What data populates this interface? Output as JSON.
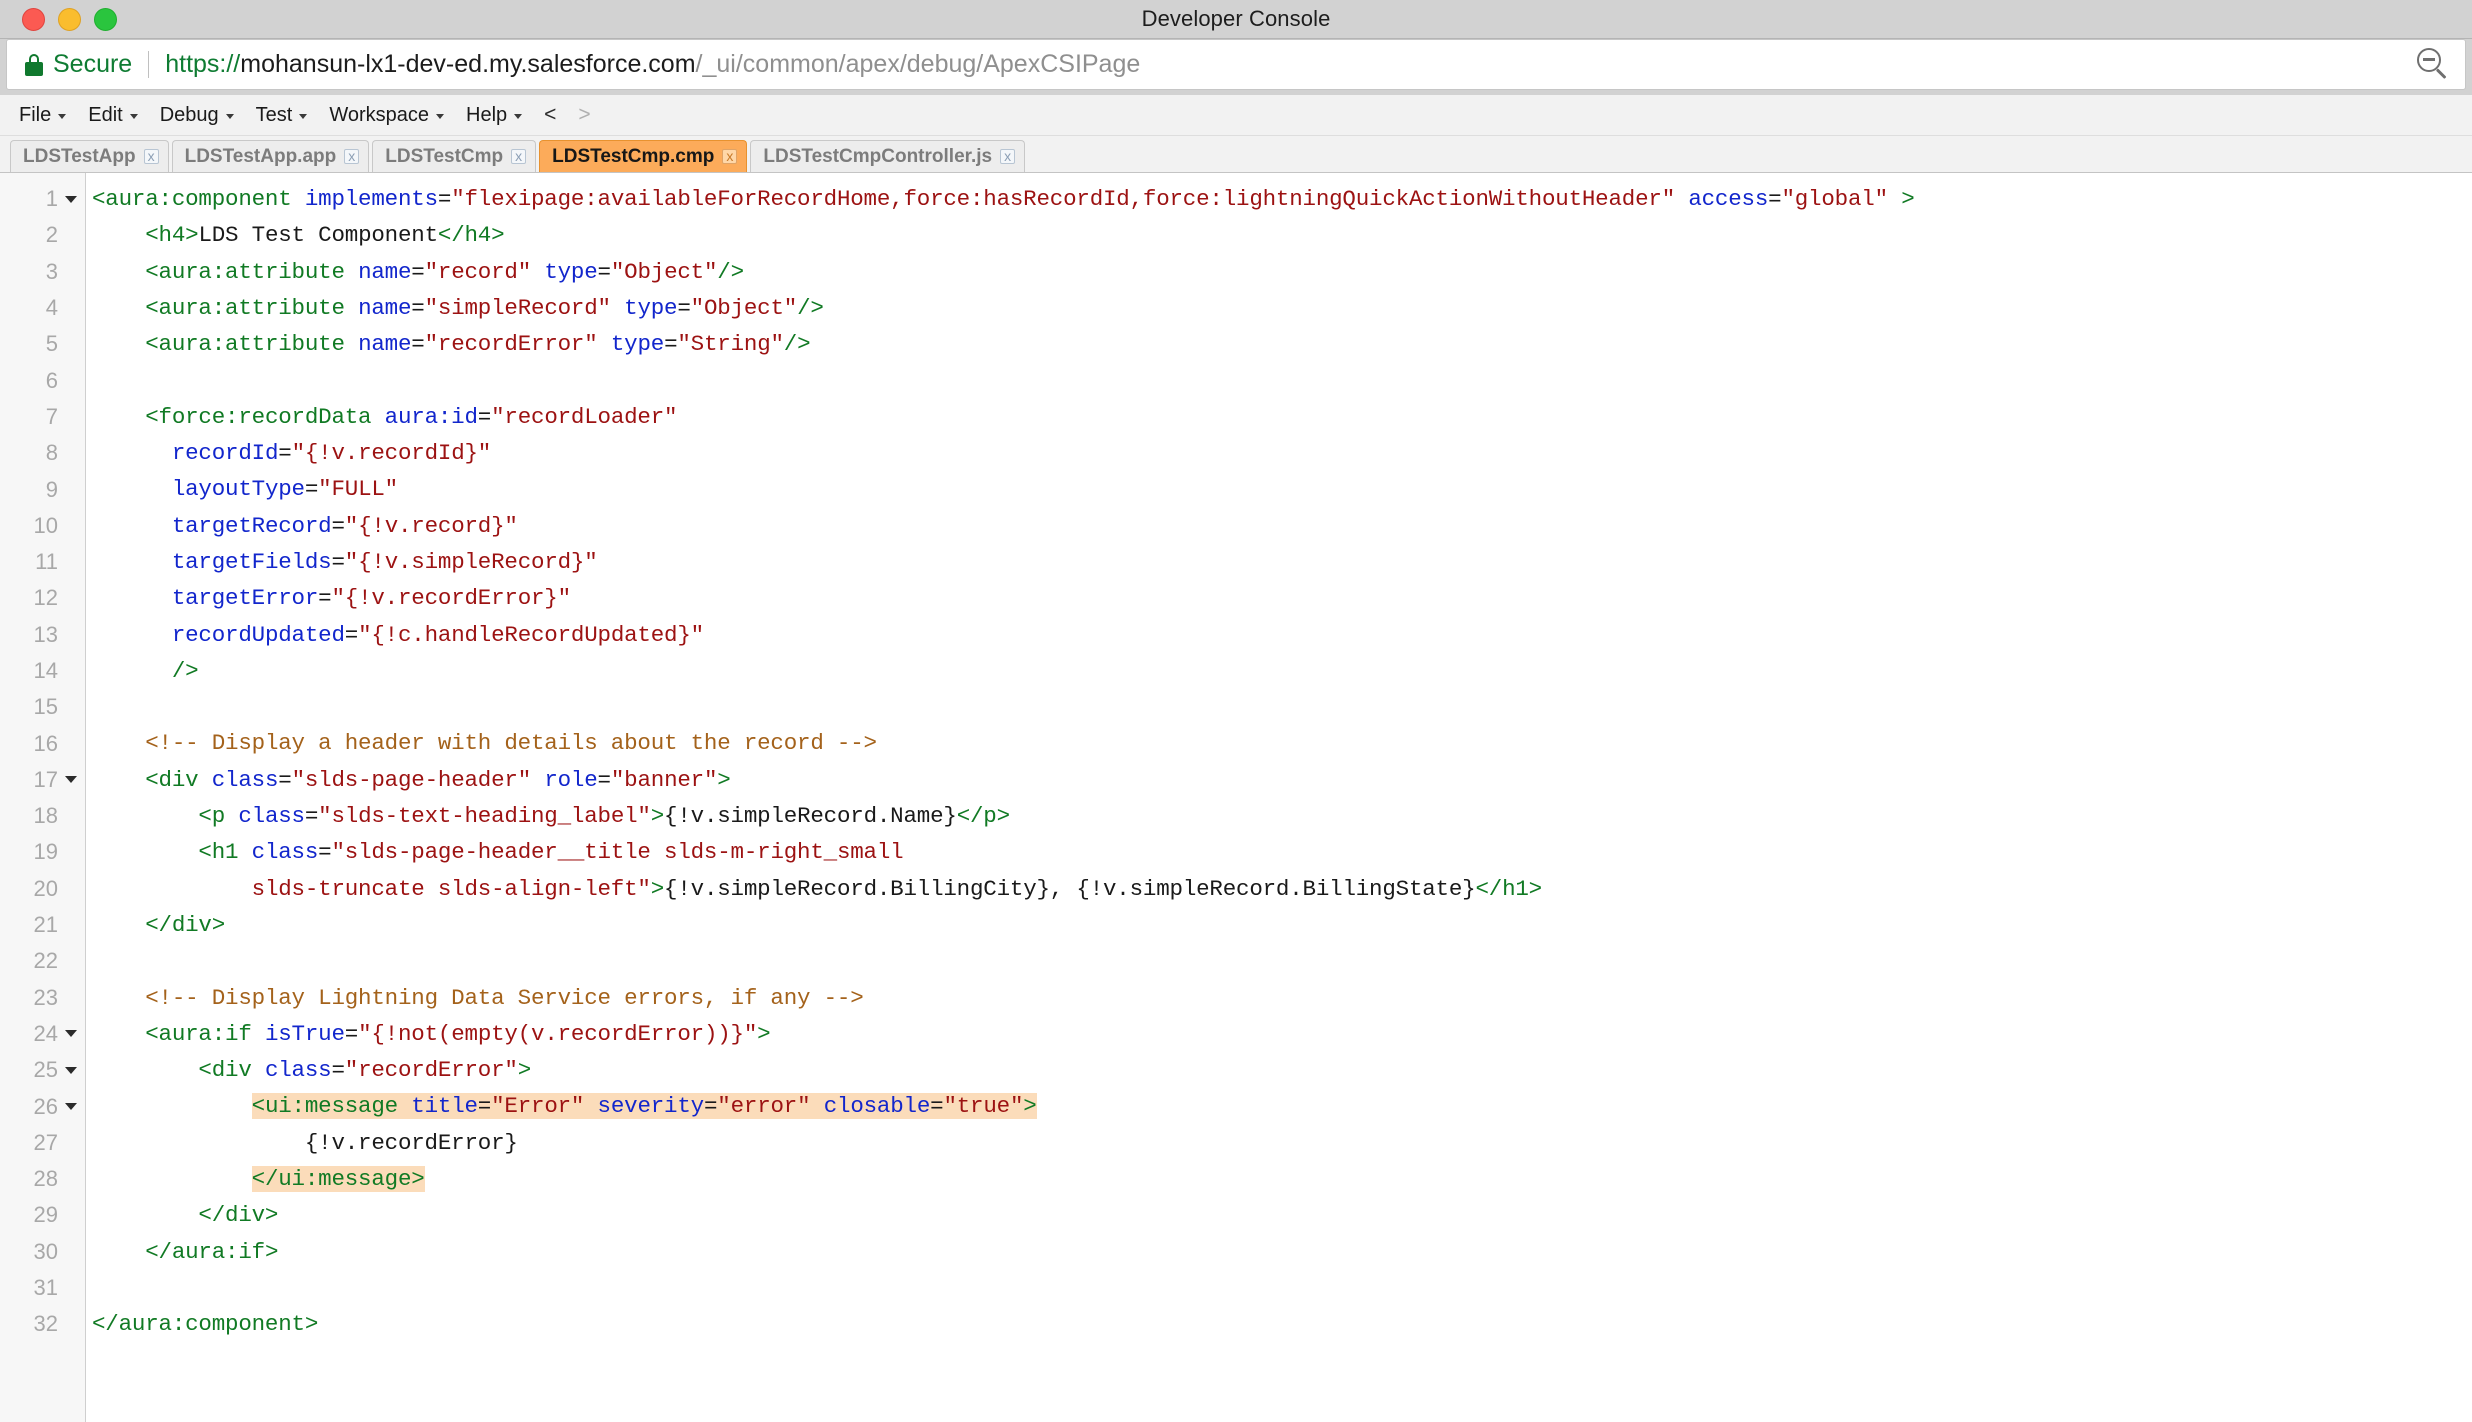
{
  "window": {
    "title": "Developer Console",
    "traffic_lights": [
      "close-red",
      "minimize-yellow",
      "maximize-green"
    ]
  },
  "urlbar": {
    "lock_icon": "lock-icon",
    "secure_label": "Secure",
    "scheme": "https://",
    "host": "mohansun-lx1-dev-ed.my.salesforce.com",
    "path": "/_ui/common/apex/debug/ApexCSIPage",
    "zoom_icon": "zoom-out-icon"
  },
  "menubar": {
    "items": [
      {
        "label": "File",
        "has_caret": true
      },
      {
        "label": "Edit",
        "has_caret": true
      },
      {
        "label": "Debug",
        "has_caret": true
      },
      {
        "label": "Test",
        "has_caret": true
      },
      {
        "label": "Workspace",
        "has_caret": true
      },
      {
        "label": "Help",
        "has_caret": true
      }
    ],
    "nav_prev": "<",
    "nav_next": ">"
  },
  "tabs": [
    {
      "label": "LDSTestApp",
      "active": false,
      "close": "x"
    },
    {
      "label": "LDSTestApp.app",
      "active": false,
      "close": "x"
    },
    {
      "label": "LDSTestCmp",
      "active": false,
      "close": "x"
    },
    {
      "label": "LDSTestCmp.cmp",
      "active": true,
      "close": "x"
    },
    {
      "label": "LDSTestCmpController.js",
      "active": false,
      "close": "x"
    }
  ],
  "editor": {
    "active_file": "LDSTestCmp.cmp",
    "total_lines": 32,
    "highlight_color": "#fbdcba",
    "lines": [
      {
        "n": 1,
        "fold": true,
        "tokens": [
          {
            "t": "tag",
            "v": "<aura:component "
          },
          {
            "t": "attr",
            "v": "implements"
          },
          {
            "t": "pun",
            "v": "="
          },
          {
            "t": "str",
            "v": "\"flexipage:availableForRecordHome,force:hasRecordId,force:lightningQuickActionWithoutHeader\""
          },
          {
            "t": "txt",
            "v": " "
          },
          {
            "t": "attr",
            "v": "access"
          },
          {
            "t": "pun",
            "v": "="
          },
          {
            "t": "str",
            "v": "\"global\""
          },
          {
            "t": "txt",
            "v": " "
          },
          {
            "t": "tag",
            "v": ">"
          }
        ]
      },
      {
        "n": 2,
        "fold": false,
        "tokens": [
          {
            "t": "txt",
            "v": "    "
          },
          {
            "t": "tag",
            "v": "<h4>"
          },
          {
            "t": "txt",
            "v": "LDS Test Component"
          },
          {
            "t": "tag",
            "v": "</h4>"
          }
        ]
      },
      {
        "n": 3,
        "fold": false,
        "tokens": [
          {
            "t": "txt",
            "v": "    "
          },
          {
            "t": "tag",
            "v": "<aura:attribute "
          },
          {
            "t": "attr",
            "v": "name"
          },
          {
            "t": "pun",
            "v": "="
          },
          {
            "t": "str",
            "v": "\"record\""
          },
          {
            "t": "txt",
            "v": " "
          },
          {
            "t": "attr",
            "v": "type"
          },
          {
            "t": "pun",
            "v": "="
          },
          {
            "t": "str",
            "v": "\"Object\""
          },
          {
            "t": "tag",
            "v": "/>"
          }
        ]
      },
      {
        "n": 4,
        "fold": false,
        "tokens": [
          {
            "t": "txt",
            "v": "    "
          },
          {
            "t": "tag",
            "v": "<aura:attribute "
          },
          {
            "t": "attr",
            "v": "name"
          },
          {
            "t": "pun",
            "v": "="
          },
          {
            "t": "str",
            "v": "\"simpleRecord\""
          },
          {
            "t": "txt",
            "v": " "
          },
          {
            "t": "attr",
            "v": "type"
          },
          {
            "t": "pun",
            "v": "="
          },
          {
            "t": "str",
            "v": "\"Object\""
          },
          {
            "t": "tag",
            "v": "/>"
          }
        ]
      },
      {
        "n": 5,
        "fold": false,
        "tokens": [
          {
            "t": "txt",
            "v": "    "
          },
          {
            "t": "tag",
            "v": "<aura:attribute "
          },
          {
            "t": "attr",
            "v": "name"
          },
          {
            "t": "pun",
            "v": "="
          },
          {
            "t": "str",
            "v": "\"recordError\""
          },
          {
            "t": "txt",
            "v": " "
          },
          {
            "t": "attr",
            "v": "type"
          },
          {
            "t": "pun",
            "v": "="
          },
          {
            "t": "str",
            "v": "\"String\""
          },
          {
            "t": "tag",
            "v": "/>"
          }
        ]
      },
      {
        "n": 6,
        "fold": false,
        "tokens": []
      },
      {
        "n": 7,
        "fold": false,
        "tokens": [
          {
            "t": "txt",
            "v": "    "
          },
          {
            "t": "tag",
            "v": "<force:recordData "
          },
          {
            "t": "attr",
            "v": "aura:id"
          },
          {
            "t": "pun",
            "v": "="
          },
          {
            "t": "str",
            "v": "\"recordLoader\""
          }
        ]
      },
      {
        "n": 8,
        "fold": false,
        "tokens": [
          {
            "t": "txt",
            "v": "      "
          },
          {
            "t": "attr",
            "v": "recordId"
          },
          {
            "t": "pun",
            "v": "="
          },
          {
            "t": "str",
            "v": "\"{!v.recordId}\""
          }
        ]
      },
      {
        "n": 9,
        "fold": false,
        "tokens": [
          {
            "t": "txt",
            "v": "      "
          },
          {
            "t": "attr",
            "v": "layoutType"
          },
          {
            "t": "pun",
            "v": "="
          },
          {
            "t": "str",
            "v": "\"FULL\""
          }
        ]
      },
      {
        "n": 10,
        "fold": false,
        "tokens": [
          {
            "t": "txt",
            "v": "      "
          },
          {
            "t": "attr",
            "v": "targetRecord"
          },
          {
            "t": "pun",
            "v": "="
          },
          {
            "t": "str",
            "v": "\"{!v.record}\""
          }
        ]
      },
      {
        "n": 11,
        "fold": false,
        "tokens": [
          {
            "t": "txt",
            "v": "      "
          },
          {
            "t": "attr",
            "v": "targetFields"
          },
          {
            "t": "pun",
            "v": "="
          },
          {
            "t": "str",
            "v": "\"{!v.simpleRecord}\""
          }
        ]
      },
      {
        "n": 12,
        "fold": false,
        "tokens": [
          {
            "t": "txt",
            "v": "      "
          },
          {
            "t": "attr",
            "v": "targetError"
          },
          {
            "t": "pun",
            "v": "="
          },
          {
            "t": "str",
            "v": "\"{!v.recordError}\""
          }
        ]
      },
      {
        "n": 13,
        "fold": false,
        "tokens": [
          {
            "t": "txt",
            "v": "      "
          },
          {
            "t": "attr",
            "v": "recordUpdated"
          },
          {
            "t": "pun",
            "v": "="
          },
          {
            "t": "str",
            "v": "\"{!c.handleRecordUpdated}\""
          }
        ]
      },
      {
        "n": 14,
        "fold": false,
        "tokens": [
          {
            "t": "txt",
            "v": "      "
          },
          {
            "t": "tag",
            "v": "/>"
          }
        ]
      },
      {
        "n": 15,
        "fold": false,
        "tokens": []
      },
      {
        "n": 16,
        "fold": false,
        "tokens": [
          {
            "t": "txt",
            "v": "    "
          },
          {
            "t": "com",
            "v": "<!-- Display a header with details about the record -->"
          }
        ]
      },
      {
        "n": 17,
        "fold": true,
        "tokens": [
          {
            "t": "txt",
            "v": "    "
          },
          {
            "t": "tag",
            "v": "<div "
          },
          {
            "t": "attr",
            "v": "class"
          },
          {
            "t": "pun",
            "v": "="
          },
          {
            "t": "str",
            "v": "\"slds-page-header\""
          },
          {
            "t": "txt",
            "v": " "
          },
          {
            "t": "attr",
            "v": "role"
          },
          {
            "t": "pun",
            "v": "="
          },
          {
            "t": "str",
            "v": "\"banner\""
          },
          {
            "t": "tag",
            "v": ">"
          }
        ]
      },
      {
        "n": 18,
        "fold": false,
        "tokens": [
          {
            "t": "txt",
            "v": "        "
          },
          {
            "t": "tag",
            "v": "<p "
          },
          {
            "t": "attr",
            "v": "class"
          },
          {
            "t": "pun",
            "v": "="
          },
          {
            "t": "str",
            "v": "\"slds-text-heading_label\""
          },
          {
            "t": "tag",
            "v": ">"
          },
          {
            "t": "txt",
            "v": "{!v.simpleRecord.Name}"
          },
          {
            "t": "tag",
            "v": "</p>"
          }
        ]
      },
      {
        "n": 19,
        "fold": false,
        "tokens": [
          {
            "t": "txt",
            "v": "        "
          },
          {
            "t": "tag",
            "v": "<h1 "
          },
          {
            "t": "attr",
            "v": "class"
          },
          {
            "t": "pun",
            "v": "="
          },
          {
            "t": "str",
            "v": "\"slds-page-header__title slds-m-right_small"
          }
        ]
      },
      {
        "n": 20,
        "fold": false,
        "tokens": [
          {
            "t": "txt",
            "v": "            "
          },
          {
            "t": "str",
            "v": "slds-truncate slds-align-left\""
          },
          {
            "t": "tag",
            "v": ">"
          },
          {
            "t": "txt",
            "v": "{!v.simpleRecord.BillingCity}, {!v.simpleRecord.BillingState}"
          },
          {
            "t": "tag",
            "v": "</h1>"
          }
        ]
      },
      {
        "n": 21,
        "fold": false,
        "tokens": [
          {
            "t": "txt",
            "v": "    "
          },
          {
            "t": "tag",
            "v": "</div>"
          }
        ]
      },
      {
        "n": 22,
        "fold": false,
        "tokens": []
      },
      {
        "n": 23,
        "fold": false,
        "tokens": [
          {
            "t": "txt",
            "v": "    "
          },
          {
            "t": "com",
            "v": "<!-- Display Lightning Data Service errors, if any -->"
          }
        ]
      },
      {
        "n": 24,
        "fold": true,
        "tokens": [
          {
            "t": "txt",
            "v": "    "
          },
          {
            "t": "tag",
            "v": "<aura:if "
          },
          {
            "t": "attr",
            "v": "isTrue"
          },
          {
            "t": "pun",
            "v": "="
          },
          {
            "t": "str",
            "v": "\"{!not(empty(v.recordError))}\""
          },
          {
            "t": "tag",
            "v": ">"
          }
        ]
      },
      {
        "n": 25,
        "fold": true,
        "tokens": [
          {
            "t": "txt",
            "v": "        "
          },
          {
            "t": "tag",
            "v": "<div "
          },
          {
            "t": "attr",
            "v": "class"
          },
          {
            "t": "pun",
            "v": "="
          },
          {
            "t": "str",
            "v": "\"recordError\""
          },
          {
            "t": "tag",
            "v": ">"
          }
        ]
      },
      {
        "n": 26,
        "fold": true,
        "highlight": true,
        "indent": "            ",
        "tokens": [
          {
            "t": "tag",
            "v": "<ui:message "
          },
          {
            "t": "attr",
            "v": "title"
          },
          {
            "t": "pun",
            "v": "="
          },
          {
            "t": "str",
            "v": "\"Error\""
          },
          {
            "t": "txt",
            "v": " "
          },
          {
            "t": "attr",
            "v": "severity"
          },
          {
            "t": "pun",
            "v": "="
          },
          {
            "t": "str",
            "v": "\"error\""
          },
          {
            "t": "txt",
            "v": " "
          },
          {
            "t": "attr",
            "v": "closable"
          },
          {
            "t": "pun",
            "v": "="
          },
          {
            "t": "str",
            "v": "\"true\""
          },
          {
            "t": "tag",
            "v": ">"
          }
        ]
      },
      {
        "n": 27,
        "fold": false,
        "tokens": [
          {
            "t": "txt",
            "v": "                {!v.recordError}"
          }
        ]
      },
      {
        "n": 28,
        "fold": false,
        "highlight": true,
        "indent": "            ",
        "tokens": [
          {
            "t": "tag",
            "v": "</ui:message>"
          }
        ]
      },
      {
        "n": 29,
        "fold": false,
        "tokens": [
          {
            "t": "txt",
            "v": "        "
          },
          {
            "t": "tag",
            "v": "</div>"
          }
        ]
      },
      {
        "n": 30,
        "fold": false,
        "tokens": [
          {
            "t": "txt",
            "v": "    "
          },
          {
            "t": "tag",
            "v": "</aura:if>"
          }
        ]
      },
      {
        "n": 31,
        "fold": false,
        "tokens": []
      },
      {
        "n": 32,
        "fold": false,
        "tokens": [
          {
            "t": "tag",
            "v": "</aura:component>"
          }
        ]
      }
    ]
  }
}
